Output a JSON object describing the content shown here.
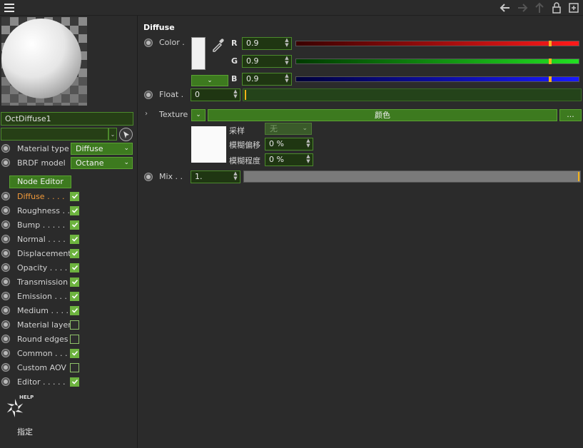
{
  "toolbar": {
    "icons": [
      "menu-icon",
      "arrow-left-icon",
      "arrow-right-icon",
      "arrow-up-icon",
      "lock-icon",
      "new-window-icon"
    ]
  },
  "material": {
    "name": "OctDiffuse1",
    "sub_value": "",
    "material_type_label": "Material type",
    "material_type_value": "Diffuse",
    "brdf_label": "BRDF model",
    "brdf_value": "Octane",
    "node_editor_label": "Node Editor"
  },
  "channels": [
    {
      "label": "Diffuse . . . .",
      "checked": true,
      "active": true
    },
    {
      "label": "Roughness . .",
      "checked": true,
      "active": false
    },
    {
      "label": "Bump . . . . .",
      "checked": true,
      "active": false
    },
    {
      "label": "Normal . . . .",
      "checked": true,
      "active": false
    },
    {
      "label": "Displacement",
      "checked": true,
      "active": false
    },
    {
      "label": "Opacity . . . .",
      "checked": true,
      "active": false
    },
    {
      "label": "Transmission",
      "checked": true,
      "active": false
    },
    {
      "label": "Emission . . .",
      "checked": true,
      "active": false
    },
    {
      "label": "Medium . . . .",
      "checked": true,
      "active": false
    },
    {
      "label": "Material layer",
      "checked": false,
      "active": false
    },
    {
      "label": "Round edges",
      "checked": false,
      "active": false
    },
    {
      "label": "Common . . .",
      "checked": true,
      "active": false
    },
    {
      "label": "Custom AOV",
      "checked": false,
      "active": false
    },
    {
      "label": "Editor . . . . .",
      "checked": true,
      "active": false
    }
  ],
  "help_label": "HELP",
  "assign_label": "指定",
  "diffuse": {
    "title": "Diffuse",
    "color_label": "Color .",
    "r_label": "R",
    "r_value": "0.9",
    "r_level": 0.9,
    "g_label": "G",
    "g_value": "0.9",
    "g_level": 0.9,
    "b_label": "B",
    "b_value": "0.9",
    "b_level": 0.9,
    "float_label": "Float .",
    "float_value": "0",
    "texture_label": "Texture",
    "texture_name": "颜色",
    "texture_more": "...",
    "sampling_label": "采样",
    "sampling_value": "无",
    "blur_offset_label": "模糊偏移",
    "blur_offset_value": "0 %",
    "blur_scale_label": "模糊程度",
    "blur_scale_value": "0 %",
    "mix_label": "Mix . .",
    "mix_value": "1.",
    "mix_level": 1.0
  },
  "colors": {
    "accent_green": "#3d7a1f",
    "active_orange": "#f29a3a",
    "knob_yellow": "#f0b020"
  }
}
